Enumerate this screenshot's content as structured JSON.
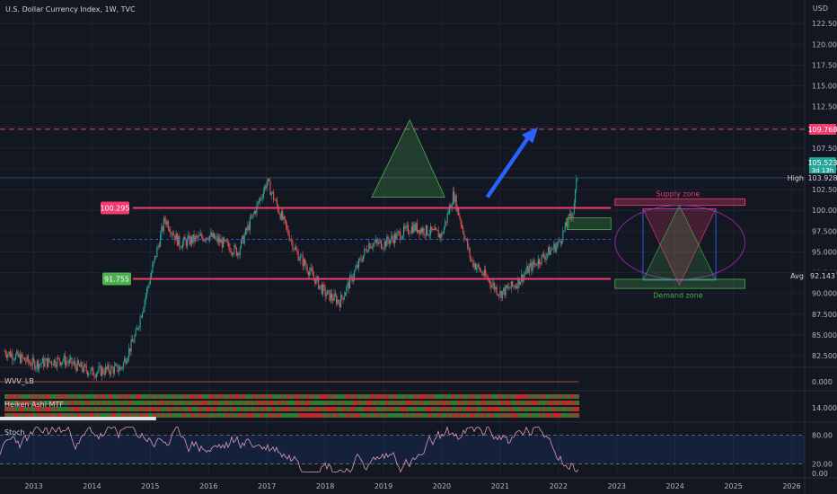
{
  "header": {
    "symbol_title": "U.S. Dollar Currency Index, 1W, TVC",
    "currency": "USD"
  },
  "colors": {
    "bg": "#131722",
    "grid": "#1e222d",
    "text": "#b2b5be",
    "bull": "#26a69a",
    "bear": "#ef5350",
    "level": "#f23b6f",
    "accent_blue": "#2962ff",
    "supply": "#f23b6f",
    "demand": "#4caf50"
  },
  "price_axis": {
    "ticks": [
      "122.500",
      "120.000",
      "117.500",
      "115.000",
      "112.500",
      "110.000",
      "107.500",
      "105.000",
      "102.500",
      "100.000",
      "97.500",
      "95.000",
      "92.500",
      "90.000",
      "87.500",
      "85.000",
      "82.500"
    ],
    "range": [
      81,
      125
    ]
  },
  "time_axis": {
    "labels": [
      "2013",
      "2014",
      "2015",
      "2016",
      "2017",
      "2018",
      "2019",
      "2020",
      "2021",
      "2022",
      "2023",
      "2024",
      "2025",
      "2026"
    ]
  },
  "badges": {
    "target": "109.768",
    "high_label": "High",
    "high_value": "103.928",
    "last_value": "105.523",
    "countdown": "3d 13h",
    "avg_label": "Avg",
    "avg_value": "92.143",
    "resistance": "100.295",
    "support": "91.755"
  },
  "zones": {
    "supply_label": "Supply zone",
    "demand_label": "Demand zone"
  },
  "indicators": {
    "wvv": {
      "name": "WVV_LB",
      "value": "0.000"
    },
    "heiken": {
      "name": "Heiken Ashi MTF",
      "value": "14.000"
    },
    "stoch": {
      "name": "Stoch",
      "ticks": [
        "80.00",
        "20.00",
        "0.00"
      ],
      "levels": [
        80,
        20
      ]
    }
  },
  "chart_data": {
    "type": "candlestick",
    "title": "U.S. Dollar Currency Index, 1W, TVC",
    "y_unit": "USD",
    "x": [
      2012.5,
      2013.0,
      2013.5,
      2014.0,
      2014.5,
      2014.75,
      2015.0,
      2015.25,
      2015.5,
      2016.0,
      2016.5,
      2016.92,
      2017.0,
      2017.5,
      2018.0,
      2018.25,
      2018.75,
      2019.0,
      2019.5,
      2020.0,
      2020.2,
      2020.5,
      2021.0,
      2021.25,
      2021.5,
      2022.0,
      2022.25,
      2022.35
    ],
    "close": [
      83,
      81.5,
      82,
      80.5,
      81,
      85,
      92,
      99,
      96,
      97,
      95,
      102,
      103.5,
      95,
      90,
      89,
      96,
      96,
      98,
      97,
      102,
      94,
      90,
      91,
      93,
      96,
      100,
      105.5
    ],
    "levels": {
      "resistance": 100.295,
      "support": 91.755,
      "target": 109.768,
      "high": 103.928,
      "avg": 92.143,
      "last": 105.523,
      "mid_dashed": 96.5
    },
    "xlim": [
      2012.5,
      2026.3
    ],
    "ylim": [
      81,
      125
    ]
  }
}
